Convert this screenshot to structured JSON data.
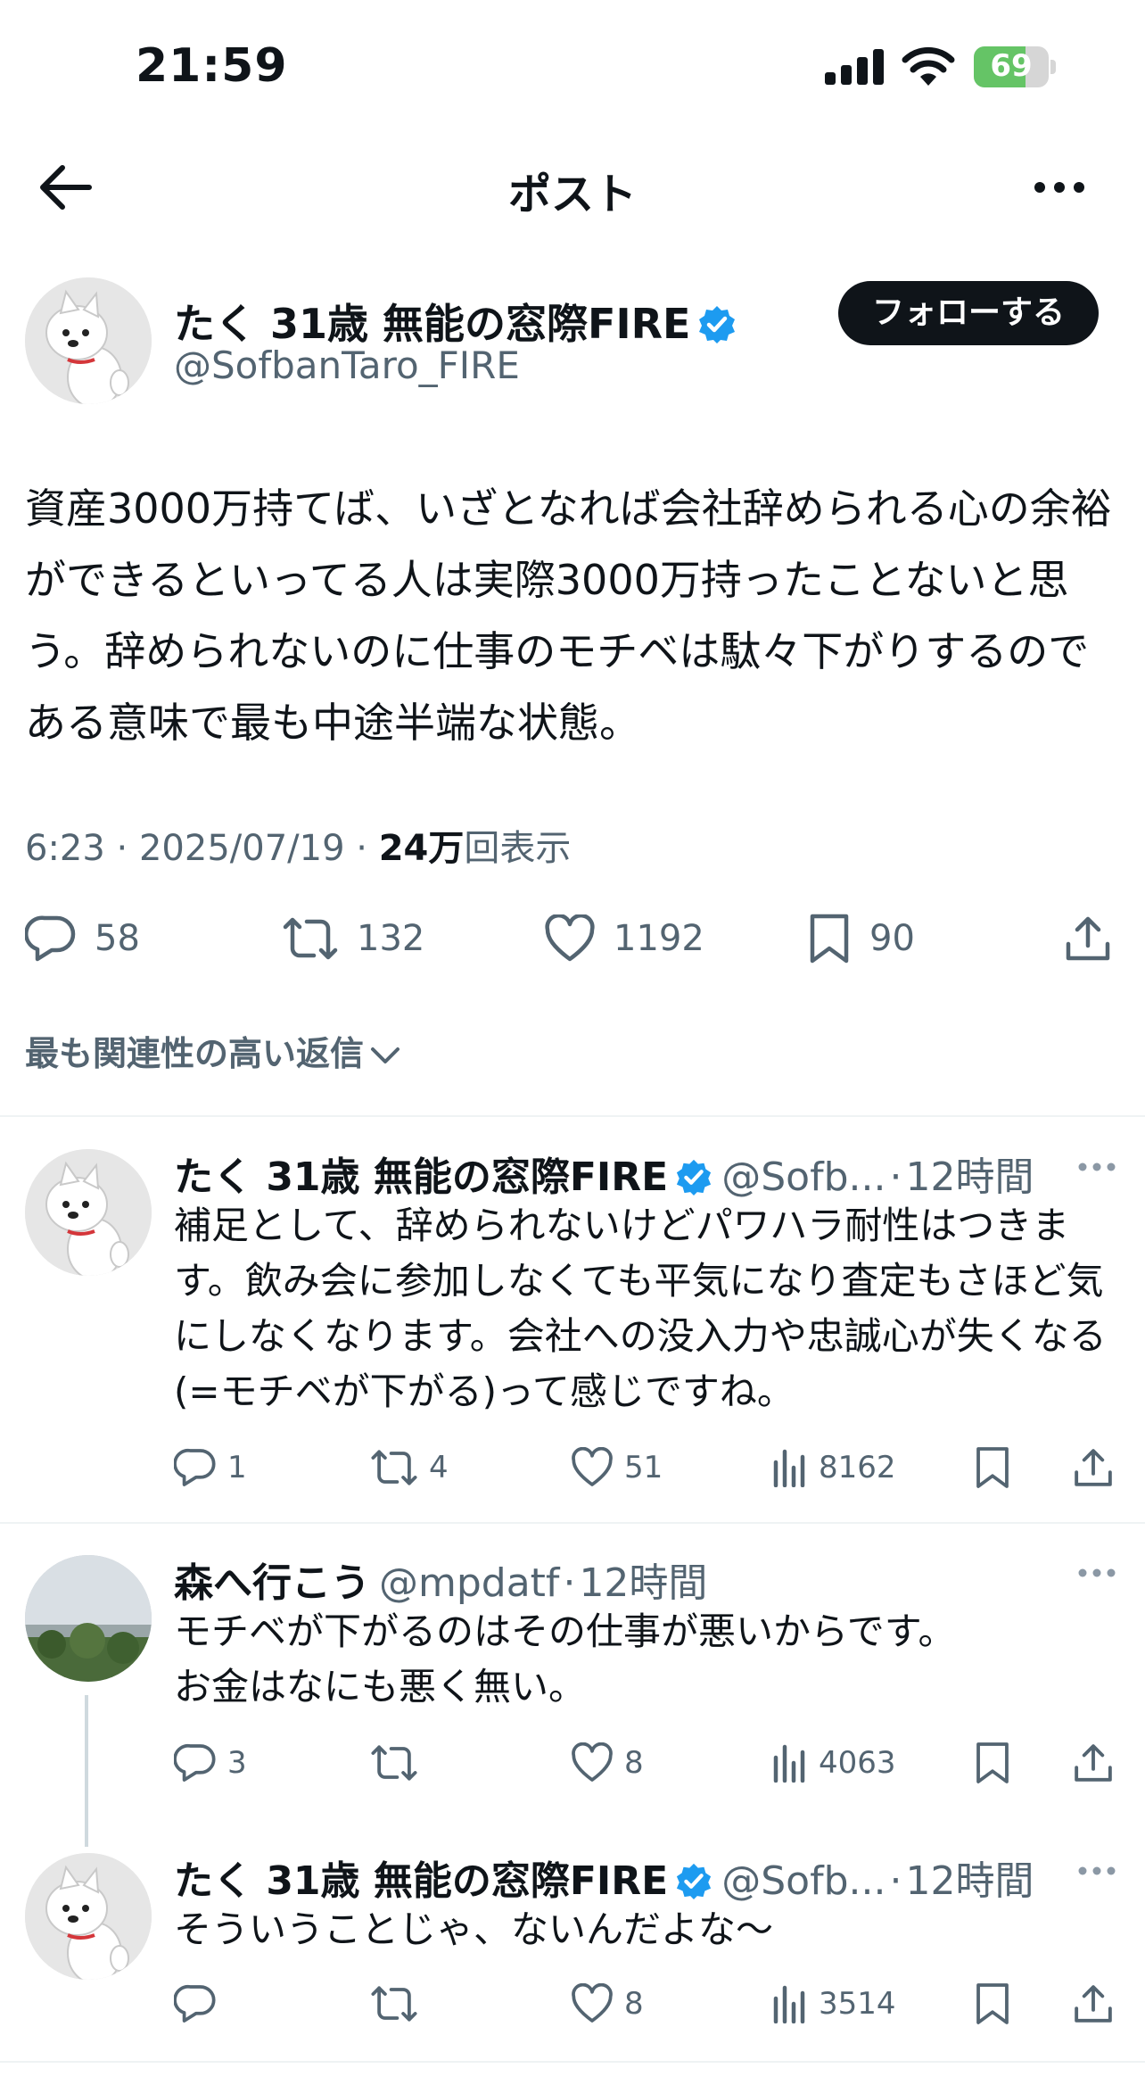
{
  "status_bar": {
    "time": "21:59",
    "battery": "69",
    "battery_level": 0.69
  },
  "nav": {
    "title": "ポスト",
    "back_icon": "arrow-left-icon",
    "more_icon": "more-horizontal-icon"
  },
  "post": {
    "author_name": "たく 31歳 無能の窓際FIRE",
    "handle": "@SofbanTaro_FIRE",
    "follow_label": "フォローする",
    "text": "資産3000万持てば、いざとなれば会社辞められる心の余裕ができるといってる人は実際3000万持ったことないと思う。辞められないのに仕事のモチベは駄々下がりするのである意味で最も中途半端な状態。",
    "time": "6:23",
    "date": "2025/07/19",
    "views": "24万",
    "views_suffix": "回表示",
    "sep": "·",
    "stats": {
      "replies": "58",
      "reposts": "132",
      "likes": "1192",
      "bookmarks": "90"
    }
  },
  "replies_filter": "最も関連性の高い返信",
  "replies": [
    {
      "name": "たく 31歳 無能の窓際FIRE",
      "handle": "@Sofb...",
      "time": "12時間",
      "verified": true,
      "text": "補足として、辞められないけどパワハラ耐性はつきます。飲み会に参加しなくても平気になり査定もさほど気にしなくなります。会社への没入力や忠誠心が失くなる(=モチベが下がる)って感じですね。",
      "replies": "1",
      "reposts": "4",
      "likes": "51",
      "views": "8162"
    },
    {
      "name": "森へ行こう",
      "handle": "@mpdatf",
      "time": "12時間",
      "verified": false,
      "text": "モチベが下がるのはその仕事が悪いからです。\nお金はなにも悪く無い。",
      "replies": "3",
      "reposts": "",
      "likes": "8",
      "views": "4063"
    },
    {
      "name": "たく 31歳 無能の窓際FIRE",
      "handle": "@Sofb...",
      "time": "12時間",
      "verified": true,
      "text": "そういうことじゃ、ないんだよな〜",
      "replies": "",
      "reposts": "",
      "likes": "8",
      "views": "3514"
    }
  ],
  "colors": {
    "accent": "#1d9bf0",
    "text": "#0f1419",
    "secondary": "#536471",
    "battery": "#65c466"
  }
}
